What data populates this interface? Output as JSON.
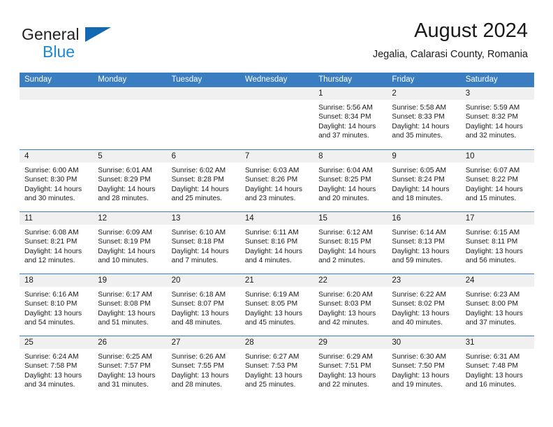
{
  "brand": {
    "name_top": "General",
    "name_bottom": "Blue",
    "accent_color": "#1c87d8",
    "triangle_color": "#1168b3"
  },
  "header": {
    "title": "August 2024",
    "subtitle": "Jegalia, Calarasi County, Romania"
  },
  "calendar": {
    "header_bg": "#3b7dc1",
    "header_text_color": "#ffffff",
    "day_header_bg": "#f0f0f0",
    "weekdays": [
      "Sunday",
      "Monday",
      "Tuesday",
      "Wednesday",
      "Thursday",
      "Friday",
      "Saturday"
    ],
    "weeks": [
      [
        {
          "empty": true
        },
        {
          "empty": true
        },
        {
          "empty": true
        },
        {
          "empty": true
        },
        {
          "day": "1",
          "sunrise": "Sunrise: 5:56 AM",
          "sunset": "Sunset: 8:34 PM",
          "daylight1": "Daylight: 14 hours",
          "daylight2": "and 37 minutes."
        },
        {
          "day": "2",
          "sunrise": "Sunrise: 5:58 AM",
          "sunset": "Sunset: 8:33 PM",
          "daylight1": "Daylight: 14 hours",
          "daylight2": "and 35 minutes."
        },
        {
          "day": "3",
          "sunrise": "Sunrise: 5:59 AM",
          "sunset": "Sunset: 8:32 PM",
          "daylight1": "Daylight: 14 hours",
          "daylight2": "and 32 minutes."
        }
      ],
      [
        {
          "day": "4",
          "sunrise": "Sunrise: 6:00 AM",
          "sunset": "Sunset: 8:30 PM",
          "daylight1": "Daylight: 14 hours",
          "daylight2": "and 30 minutes."
        },
        {
          "day": "5",
          "sunrise": "Sunrise: 6:01 AM",
          "sunset": "Sunset: 8:29 PM",
          "daylight1": "Daylight: 14 hours",
          "daylight2": "and 28 minutes."
        },
        {
          "day": "6",
          "sunrise": "Sunrise: 6:02 AM",
          "sunset": "Sunset: 8:28 PM",
          "daylight1": "Daylight: 14 hours",
          "daylight2": "and 25 minutes."
        },
        {
          "day": "7",
          "sunrise": "Sunrise: 6:03 AM",
          "sunset": "Sunset: 8:26 PM",
          "daylight1": "Daylight: 14 hours",
          "daylight2": "and 23 minutes."
        },
        {
          "day": "8",
          "sunrise": "Sunrise: 6:04 AM",
          "sunset": "Sunset: 8:25 PM",
          "daylight1": "Daylight: 14 hours",
          "daylight2": "and 20 minutes."
        },
        {
          "day": "9",
          "sunrise": "Sunrise: 6:05 AM",
          "sunset": "Sunset: 8:24 PM",
          "daylight1": "Daylight: 14 hours",
          "daylight2": "and 18 minutes."
        },
        {
          "day": "10",
          "sunrise": "Sunrise: 6:07 AM",
          "sunset": "Sunset: 8:22 PM",
          "daylight1": "Daylight: 14 hours",
          "daylight2": "and 15 minutes."
        }
      ],
      [
        {
          "day": "11",
          "sunrise": "Sunrise: 6:08 AM",
          "sunset": "Sunset: 8:21 PM",
          "daylight1": "Daylight: 14 hours",
          "daylight2": "and 12 minutes."
        },
        {
          "day": "12",
          "sunrise": "Sunrise: 6:09 AM",
          "sunset": "Sunset: 8:19 PM",
          "daylight1": "Daylight: 14 hours",
          "daylight2": "and 10 minutes."
        },
        {
          "day": "13",
          "sunrise": "Sunrise: 6:10 AM",
          "sunset": "Sunset: 8:18 PM",
          "daylight1": "Daylight: 14 hours",
          "daylight2": "and 7 minutes."
        },
        {
          "day": "14",
          "sunrise": "Sunrise: 6:11 AM",
          "sunset": "Sunset: 8:16 PM",
          "daylight1": "Daylight: 14 hours",
          "daylight2": "and 4 minutes."
        },
        {
          "day": "15",
          "sunrise": "Sunrise: 6:12 AM",
          "sunset": "Sunset: 8:15 PM",
          "daylight1": "Daylight: 14 hours",
          "daylight2": "and 2 minutes."
        },
        {
          "day": "16",
          "sunrise": "Sunrise: 6:14 AM",
          "sunset": "Sunset: 8:13 PM",
          "daylight1": "Daylight: 13 hours",
          "daylight2": "and 59 minutes."
        },
        {
          "day": "17",
          "sunrise": "Sunrise: 6:15 AM",
          "sunset": "Sunset: 8:11 PM",
          "daylight1": "Daylight: 13 hours",
          "daylight2": "and 56 minutes."
        }
      ],
      [
        {
          "day": "18",
          "sunrise": "Sunrise: 6:16 AM",
          "sunset": "Sunset: 8:10 PM",
          "daylight1": "Daylight: 13 hours",
          "daylight2": "and 54 minutes."
        },
        {
          "day": "19",
          "sunrise": "Sunrise: 6:17 AM",
          "sunset": "Sunset: 8:08 PM",
          "daylight1": "Daylight: 13 hours",
          "daylight2": "and 51 minutes."
        },
        {
          "day": "20",
          "sunrise": "Sunrise: 6:18 AM",
          "sunset": "Sunset: 8:07 PM",
          "daylight1": "Daylight: 13 hours",
          "daylight2": "and 48 minutes."
        },
        {
          "day": "21",
          "sunrise": "Sunrise: 6:19 AM",
          "sunset": "Sunset: 8:05 PM",
          "daylight1": "Daylight: 13 hours",
          "daylight2": "and 45 minutes."
        },
        {
          "day": "22",
          "sunrise": "Sunrise: 6:20 AM",
          "sunset": "Sunset: 8:03 PM",
          "daylight1": "Daylight: 13 hours",
          "daylight2": "and 42 minutes."
        },
        {
          "day": "23",
          "sunrise": "Sunrise: 6:22 AM",
          "sunset": "Sunset: 8:02 PM",
          "daylight1": "Daylight: 13 hours",
          "daylight2": "and 40 minutes."
        },
        {
          "day": "24",
          "sunrise": "Sunrise: 6:23 AM",
          "sunset": "Sunset: 8:00 PM",
          "daylight1": "Daylight: 13 hours",
          "daylight2": "and 37 minutes."
        }
      ],
      [
        {
          "day": "25",
          "sunrise": "Sunrise: 6:24 AM",
          "sunset": "Sunset: 7:58 PM",
          "daylight1": "Daylight: 13 hours",
          "daylight2": "and 34 minutes."
        },
        {
          "day": "26",
          "sunrise": "Sunrise: 6:25 AM",
          "sunset": "Sunset: 7:57 PM",
          "daylight1": "Daylight: 13 hours",
          "daylight2": "and 31 minutes."
        },
        {
          "day": "27",
          "sunrise": "Sunrise: 6:26 AM",
          "sunset": "Sunset: 7:55 PM",
          "daylight1": "Daylight: 13 hours",
          "daylight2": "and 28 minutes."
        },
        {
          "day": "28",
          "sunrise": "Sunrise: 6:27 AM",
          "sunset": "Sunset: 7:53 PM",
          "daylight1": "Daylight: 13 hours",
          "daylight2": "and 25 minutes."
        },
        {
          "day": "29",
          "sunrise": "Sunrise: 6:29 AM",
          "sunset": "Sunset: 7:51 PM",
          "daylight1": "Daylight: 13 hours",
          "daylight2": "and 22 minutes."
        },
        {
          "day": "30",
          "sunrise": "Sunrise: 6:30 AM",
          "sunset": "Sunset: 7:50 PM",
          "daylight1": "Daylight: 13 hours",
          "daylight2": "and 19 minutes."
        },
        {
          "day": "31",
          "sunrise": "Sunrise: 6:31 AM",
          "sunset": "Sunset: 7:48 PM",
          "daylight1": "Daylight: 13 hours",
          "daylight2": "and 16 minutes."
        }
      ]
    ]
  }
}
